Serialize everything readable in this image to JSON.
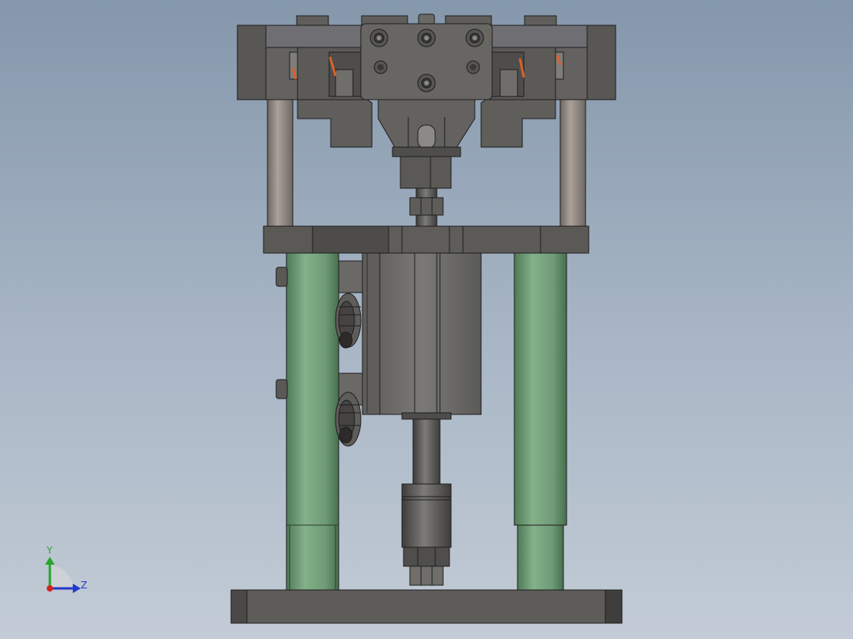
{
  "view": {
    "background_top": "#8497ab",
    "background_bottom": "#c3ccd6"
  },
  "colors": {
    "steel_dark": "#4e4d4b",
    "steel_mid": "#6a6966",
    "steel_light": "#8a8986",
    "plate_top": "#6f6e73",
    "guide_post": "#8e8580",
    "green_column": "#6f9a76",
    "green_column_light": "#84b08a",
    "spring_orange": "#d9622b",
    "outline": "#1e1e1e",
    "triad_x": "#d22222",
    "triad_y": "#27a52b",
    "triad_z": "#2439c9"
  },
  "triad": {
    "y_label": "Y",
    "z_label": "Z"
  }
}
